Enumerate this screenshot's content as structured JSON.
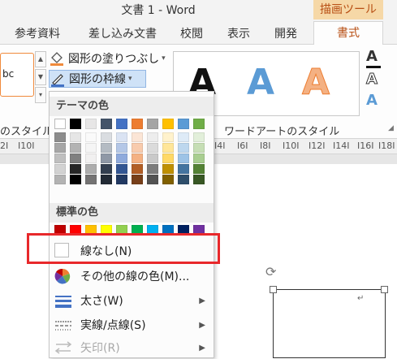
{
  "window": {
    "title": "文書 1 - Word",
    "contextual_tab_group": "描画ツール"
  },
  "tabs": [
    {
      "label": "参考資料"
    },
    {
      "label": "差し込み文書"
    },
    {
      "label": "校閲"
    },
    {
      "label": "表示"
    },
    {
      "label": "開発"
    },
    {
      "label": "書式",
      "active": true
    }
  ],
  "ribbon": {
    "shape_style_sample": "bc",
    "shape_fill_label": "図形の塗りつぶし",
    "shape_outline_label": "図形の枠線",
    "shape_styles_group": "のスタイル",
    "wordart_styles_group": "ワードアートのスタイル",
    "wordart_letter": "A",
    "text_fill_letter": "A",
    "text_outline_letter": "A",
    "text_effects_letter": "A"
  },
  "ruler": {
    "left_marks": [
      "2I",
      "I10I"
    ],
    "right_marks": [
      "I4I",
      "I6I",
      "I8I",
      "I10I",
      "I12I",
      "I14I",
      "I16I",
      "I18I"
    ]
  },
  "dropdown": {
    "theme_colors_header": "テーマの色",
    "standard_colors_header": "標準の色",
    "no_outline": "線なし(N)",
    "more_colors": "その他の線の色(M)...",
    "weight": "太さ(W)",
    "dashes": "実線/点線(S)",
    "arrows": "矢印(R)",
    "theme_colors": [
      "#ffffff",
      "#000000",
      "#e7e6e6",
      "#44546a",
      "#4472c4",
      "#ed7d31",
      "#a5a5a5",
      "#ffc000",
      "#5b9bd5",
      "#70ad47"
    ],
    "standard_colors": [
      "#c00000",
      "#ff0000",
      "#ffc000",
      "#ffff00",
      "#92d050",
      "#00b050",
      "#00b0f0",
      "#0070c0",
      "#002060",
      "#7030a0"
    ]
  },
  "colors": {
    "accent": "#b84f14",
    "highlight": "#e8282b",
    "selected": "#cfe2f7"
  }
}
